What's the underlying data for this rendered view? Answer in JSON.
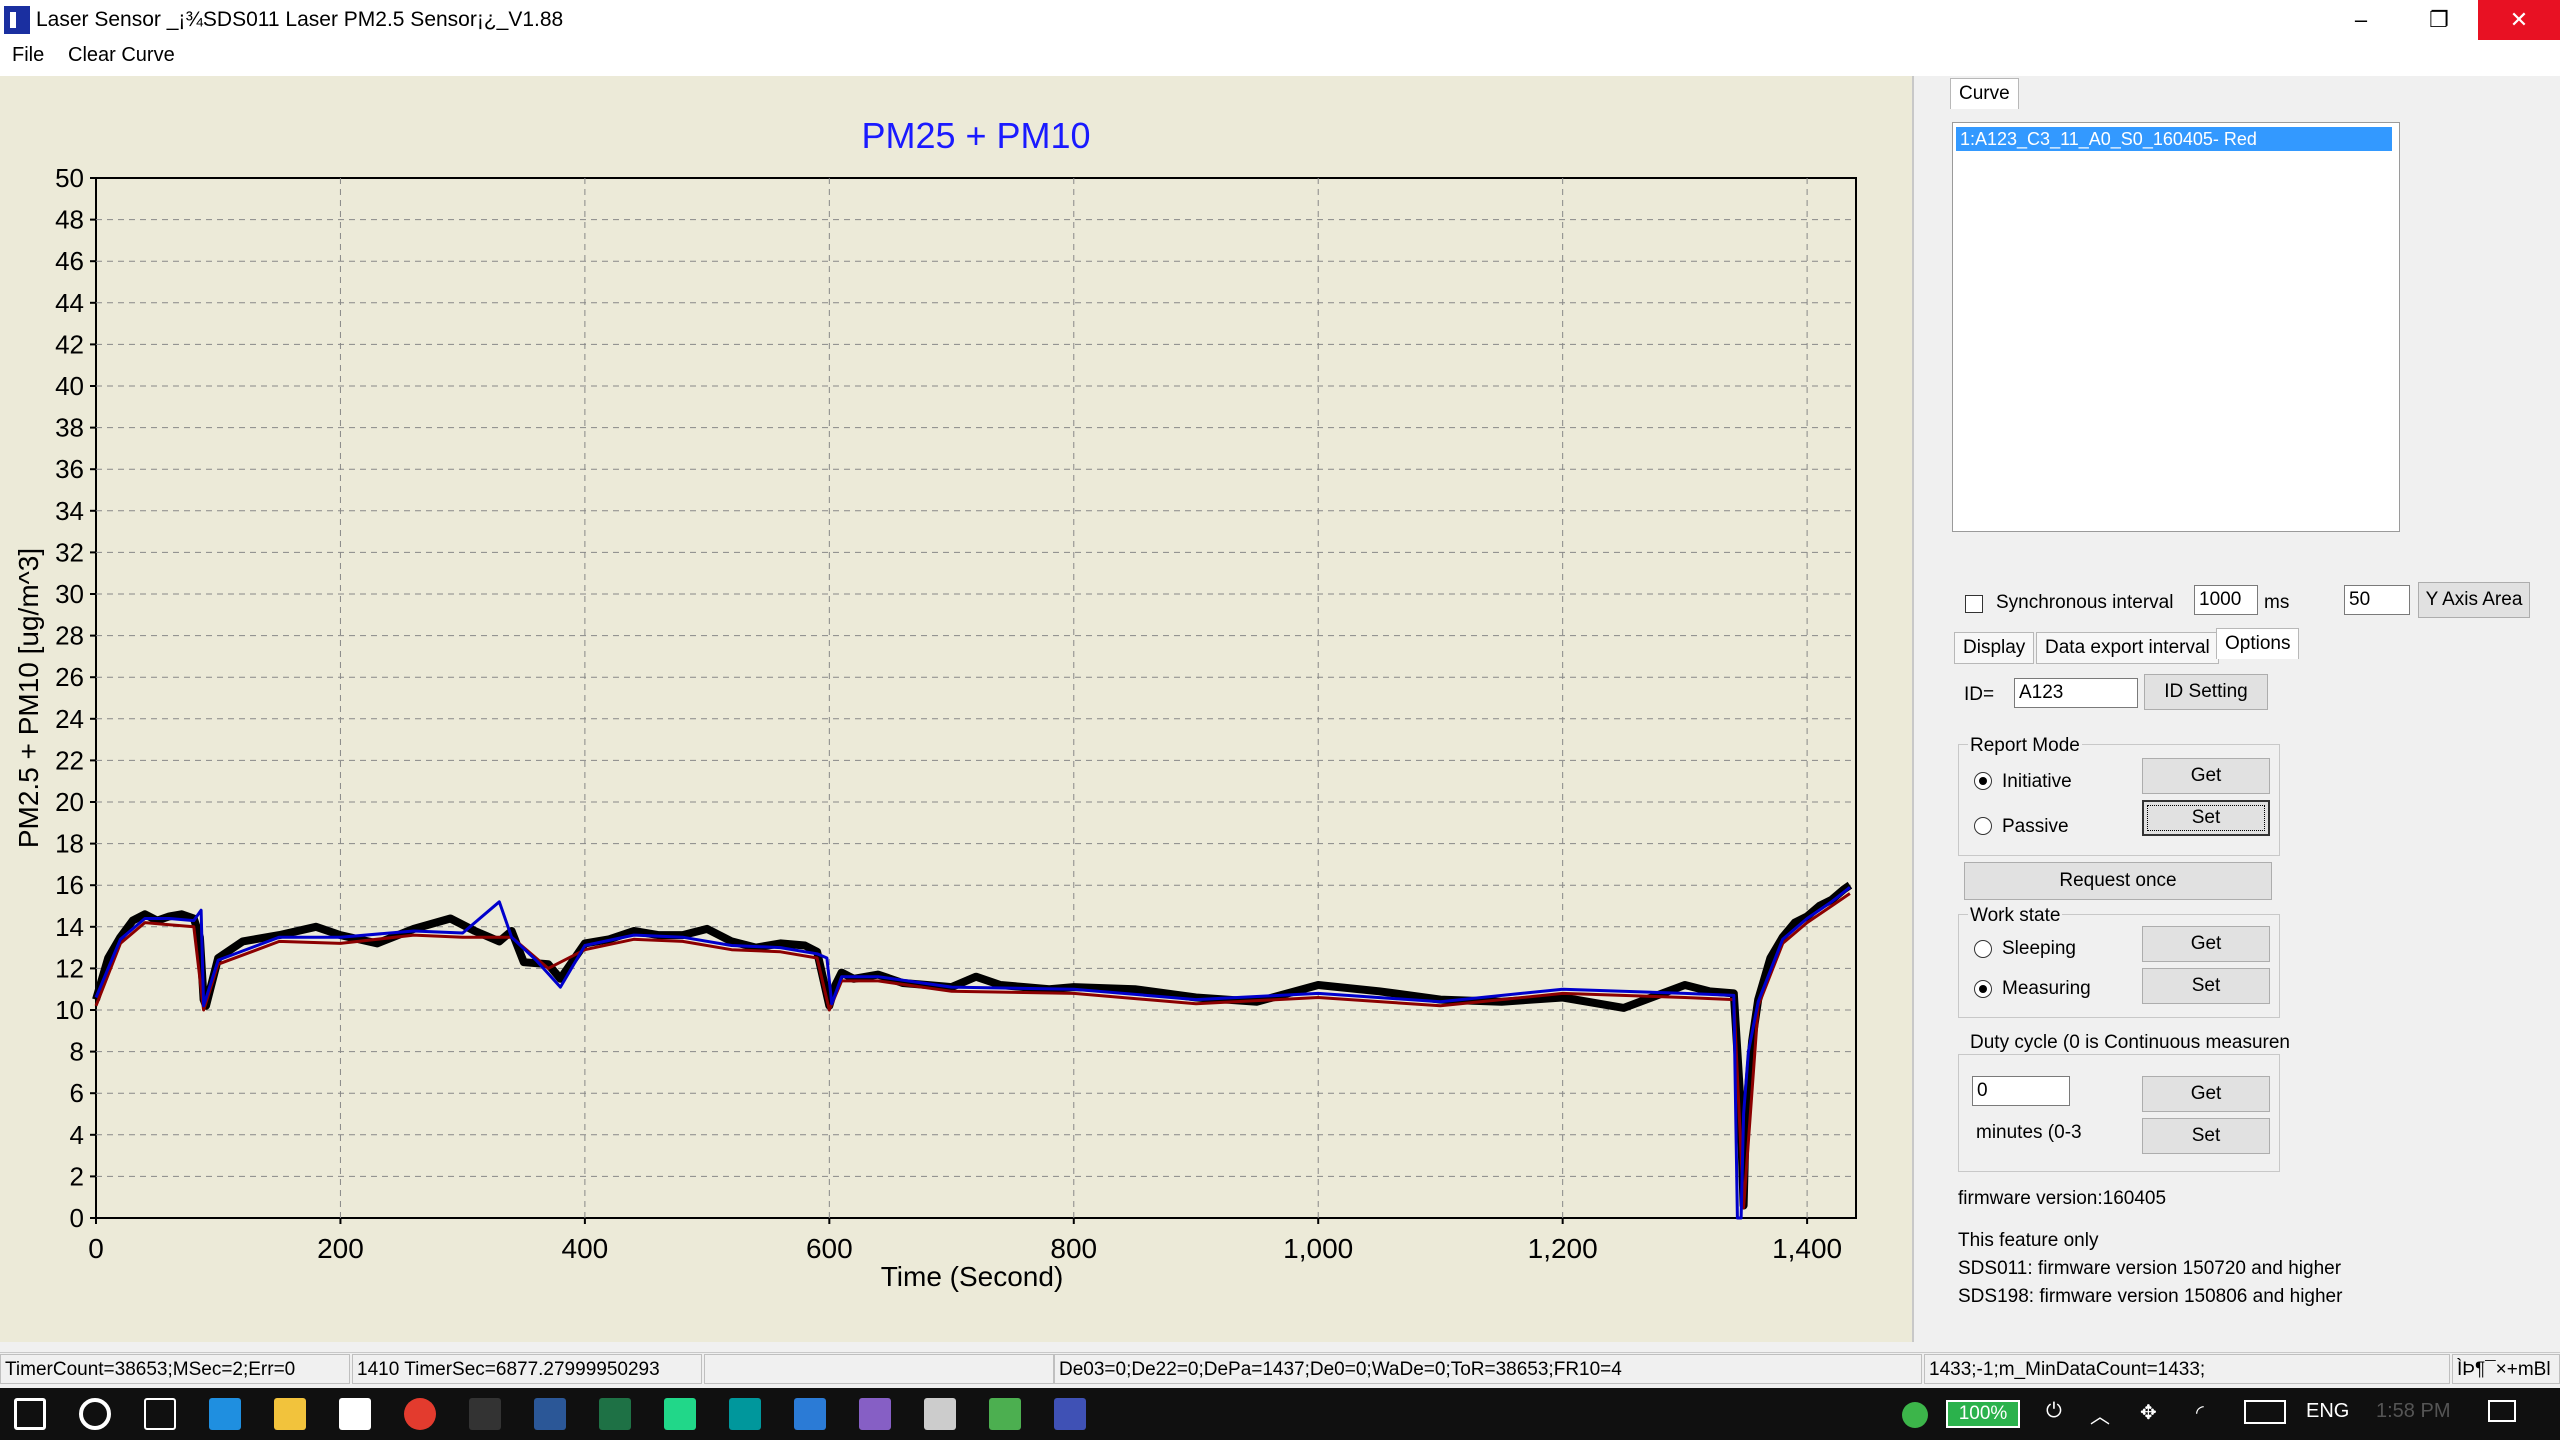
{
  "window": {
    "title": "Laser Sensor _¡¾SDS011 Laser PM2.5 Sensor¡¿_V1.88",
    "minimize_glyph": "–",
    "restore_glyph": "❐",
    "close_glyph": "✕"
  },
  "menu": {
    "file": "File",
    "clear_curve": "Clear Curve"
  },
  "chart_data": {
    "type": "line",
    "title": "PM25 + PM10",
    "xlabel": "Time (Second)",
    "ylabel": "PM2.5 + PM10 [ug/m^3]",
    "xlim": [
      0,
      1440
    ],
    "ylim": [
      0,
      50
    ],
    "xticks": [
      "0",
      "200",
      "400",
      "600",
      "800",
      "1,000",
      "1,200",
      "1,400"
    ],
    "yticks": [
      "0",
      "2",
      "4",
      "6",
      "8",
      "10",
      "12",
      "14",
      "16",
      "18",
      "20",
      "22",
      "24",
      "26",
      "28",
      "30",
      "32",
      "34",
      "36",
      "38",
      "40",
      "42",
      "44",
      "46",
      "48",
      "50"
    ],
    "grid": true,
    "title_color": "#1a1aff",
    "series": [
      {
        "color": "#000000",
        "x": [
          0,
          10,
          20,
          30,
          40,
          50,
          60,
          70,
          80,
          85,
          88,
          90,
          100,
          120,
          150,
          180,
          200,
          230,
          260,
          290,
          310,
          330,
          340,
          350,
          370,
          380,
          400,
          420,
          440,
          460,
          480,
          500,
          520,
          540,
          560,
          580,
          590,
          595,
          600,
          605,
          610,
          620,
          640,
          660,
          680,
          700,
          720,
          740,
          760,
          780,
          800,
          850,
          900,
          950,
          1000,
          1050,
          1100,
          1150,
          1200,
          1250,
          1300,
          1320,
          1340,
          1345,
          1348,
          1350,
          1355,
          1360,
          1370,
          1380,
          1390,
          1400,
          1410,
          1420,
          1430,
          1435
        ],
        "y": [
          10.5,
          12.5,
          13.5,
          14.3,
          14.6,
          14.3,
          14.5,
          14.6,
          14.4,
          13.5,
          10.5,
          10.2,
          12.5,
          13.3,
          13.6,
          14,
          13.6,
          13.2,
          13.9,
          14.4,
          13.8,
          13.3,
          13.8,
          12.3,
          12.2,
          11.5,
          13.2,
          13.4,
          13.8,
          13.6,
          13.6,
          13.9,
          13.3,
          13,
          13.2,
          13.1,
          12.8,
          11.5,
          10.2,
          11.2,
          11.8,
          11.5,
          11.7,
          11.3,
          11.2,
          11.1,
          11.6,
          11.2,
          11.1,
          11,
          11.1,
          11,
          10.6,
          10.4,
          11.2,
          10.9,
          10.5,
          10.4,
          10.6,
          10.1,
          11.2,
          10.9,
          10.8,
          6,
          0.6,
          5,
          8.5,
          10.5,
          12.5,
          13.5,
          14.2,
          14.5,
          15,
          15.3,
          15.8,
          16
        ],
        "name": ""
      },
      {
        "color": "#8b0000",
        "x": [
          0,
          20,
          40,
          60,
          80,
          88,
          100,
          150,
          200,
          260,
          300,
          340,
          370,
          400,
          440,
          480,
          520,
          560,
          590,
          600,
          610,
          640,
          700,
          800,
          900,
          1000,
          1100,
          1200,
          1300,
          1340,
          1348,
          1360,
          1380,
          1400,
          1420,
          1435
        ],
        "y": [
          10.2,
          13.2,
          14.2,
          14.1,
          14,
          10,
          12.2,
          13.3,
          13.2,
          13.6,
          13.5,
          13.5,
          12,
          12.9,
          13.4,
          13.3,
          12.9,
          12.8,
          12.5,
          10,
          11.4,
          11.4,
          10.9,
          10.8,
          10.3,
          10.6,
          10.2,
          10.8,
          10.6,
          10.5,
          0.5,
          10.2,
          13.2,
          14.2,
          15,
          15.6
        ]
      },
      {
        "color": "#0000cc",
        "x": [
          0,
          20,
          40,
          60,
          80,
          86,
          88,
          100,
          150,
          200,
          260,
          300,
          330,
          340,
          360,
          380,
          400,
          440,
          480,
          520,
          560,
          590,
          598,
          602,
          610,
          640,
          700,
          800,
          900,
          1000,
          1100,
          1200,
          1300,
          1340,
          1343,
          1346,
          1348,
          1352,
          1360,
          1380,
          1400,
          1420,
          1435
        ],
        "y": [
          10.6,
          13.4,
          14.4,
          14.4,
          14.3,
          14.8,
          10.2,
          12.4,
          13.5,
          13.5,
          13.8,
          13.7,
          15.2,
          13.5,
          12.4,
          11.1,
          13.1,
          13.6,
          13.5,
          13.1,
          13,
          12.7,
          12.5,
          10.3,
          11.6,
          11.6,
          11.1,
          11,
          10.5,
          10.8,
          10.4,
          11,
          10.8,
          10.7,
          0,
          0,
          5,
          8,
          10.4,
          13.4,
          14.4,
          15.2,
          15.9
        ]
      }
    ]
  },
  "right_panel": {
    "curve_tab": "Curve",
    "curve_list": [
      "1:A123_C3_11_A0_S0_160405- Red"
    ],
    "sync_label": "Synchronous interval",
    "sync_value": "1000",
    "sync_unit": "ms",
    "yaxis_value": "50",
    "yaxis_button": "Y Axis Area",
    "tabs": [
      "Display",
      "Data export interval",
      "Options"
    ],
    "id_label": "ID=",
    "id_value": "A123",
    "id_button": "ID Setting",
    "report_mode": {
      "title": "Report Mode",
      "initiative": "Initiative",
      "passive": "Passive",
      "get": "Get",
      "set": "Set"
    },
    "request_once": "Request once",
    "work_state": {
      "title": "Work state",
      "sleeping": "Sleeping",
      "measuring": "Measuring",
      "get": "Get",
      "set": "Set"
    },
    "duty_cycle": {
      "title": "Duty cycle (0 is Continuous measuren",
      "value": "0",
      "unit": "minutes (0-3",
      "get": "Get",
      "set": "Set"
    },
    "firmware": "firmware version:160405",
    "feature_note": [
      "This feature only",
      "SDS011: firmware version 150720 and higher",
      "SDS198: firmware version 150806 and higher"
    ]
  },
  "status": {
    "p1": "TimerCount=38653;MSec=2;Err=0",
    "p2": "1410 TimerSec=6877.27999950293",
    "p3": "",
    "p4": "De03=0;De22=0;DePa=1437;De0=0;WaDe=0;ToR=38653;FR10=4",
    "p5": "1433;-1;m_MinDataCount=1433;",
    "p6": "ÌÞ¶¯×+mBl"
  },
  "taskbar": {
    "battery": "100%",
    "lang": "ENG",
    "time": "1:58 PM",
    "icons": [
      "windows-start-icon",
      "cortana-icon",
      "task-view-icon",
      "edge-icon",
      "file-explorer-icon",
      "store-icon",
      "chrome-icon",
      "terminal-icon",
      "word-icon",
      "excel-icon",
      "pycharm-icon",
      "arduino-icon",
      "vscode-icon",
      "visual-studio-icon",
      "app-icon",
      "app-icon",
      "laser-sensor-icon"
    ]
  }
}
